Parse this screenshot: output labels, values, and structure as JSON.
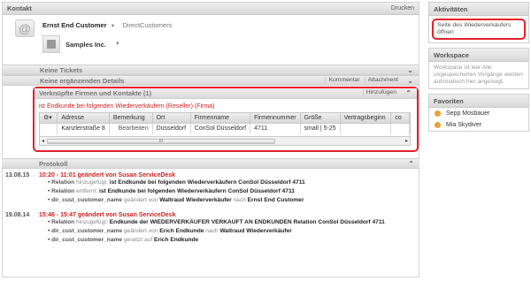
{
  "kontakt": {
    "title": "Kontakt",
    "print": "Drucken"
  },
  "customer": {
    "name": "Ernst End Customer",
    "group": "DirectCustomers",
    "org": "Samples Inc."
  },
  "sections": {
    "tickets": "Keine Tickets",
    "details": "Keine ergänzenden Details",
    "comment": "Kommentar",
    "attachment": "Attachment"
  },
  "linked": {
    "title": "Verknüpfte Firmen und Kontakte (1)",
    "add": "Hinzufügen",
    "relation": "ist Endkunde bei folgenden Wiederverkäufern (Reseller) (Firma)",
    "columns": [
      "Adresse",
      "Bemerkung",
      "Ort",
      "Firmenname",
      "Firmennummer",
      "Größe",
      "Vertragsbeginn",
      "co"
    ],
    "row": [
      "Kanzlerstraße 8",
      "Bearbeiten",
      "Düsseldorf",
      "ConSol Düsseldorf",
      "4711",
      "small | 5-25",
      "",
      ""
    ],
    "scroll_grip": "III"
  },
  "protokoll": {
    "title": "Protokoll",
    "entries": [
      {
        "date": "13.08.15",
        "head": "10:20 - 11:01 geändert von Susan ServiceDesk",
        "lines": [
          {
            "k": "Relation",
            "m": "hinzugefügt:",
            "v": "ist Endkunde bei folgenden Wiederverkäufern ConSol Düsseldorf 4711"
          },
          {
            "k": "Relation",
            "m": "entfernt:",
            "v": "ist Endkunde bei folgenden Wiederverkäufern ConSol Düsseldorf 4711"
          },
          {
            "k": "dir_cust_customer_name",
            "m": "geändert von",
            "v": "Waltraud Wiederverkäufer",
            "m2": "nach",
            "v2": "Ernst End Customer"
          }
        ]
      },
      {
        "date": "19.08.14",
        "head": "15:46 - 15:47 geändert von Susan ServiceDesk",
        "lines": [
          {
            "k": "Relation",
            "m": "hinzugefügt:",
            "v": "Endkunde der WIEDERVERKÄUFER VERKAUFT AN ENDKUNDEN Relation ConSol Düsseldorf 4711"
          },
          {
            "k": "dir_cust_customer_name",
            "m": "geändert von",
            "v": "Erich Endkunde",
            "m2": "nach",
            "v2": "Waltraud Wiederverkäufer"
          },
          {
            "k": "dir_cust_customer_name",
            "m": "gesetzt auf",
            "v": "Erich Endkunde"
          }
        ]
      }
    ]
  },
  "side": {
    "aktivitaeten": {
      "title": "Aktivitäten",
      "action": "Seite des Wiederverkäufers öffnen"
    },
    "workspace": {
      "title": "Workspace",
      "text": "Workspace ist leer Alle ungespeicherten Vorgänge werden automatisch hier angezeigt."
    },
    "favoriten": {
      "title": "Favoriten",
      "items": [
        "Sepp Mosbauer",
        "Mia Skydiver"
      ]
    }
  },
  "colors": {
    "accent_red": "#e4202a",
    "link_red": "#cc1f1f"
  }
}
